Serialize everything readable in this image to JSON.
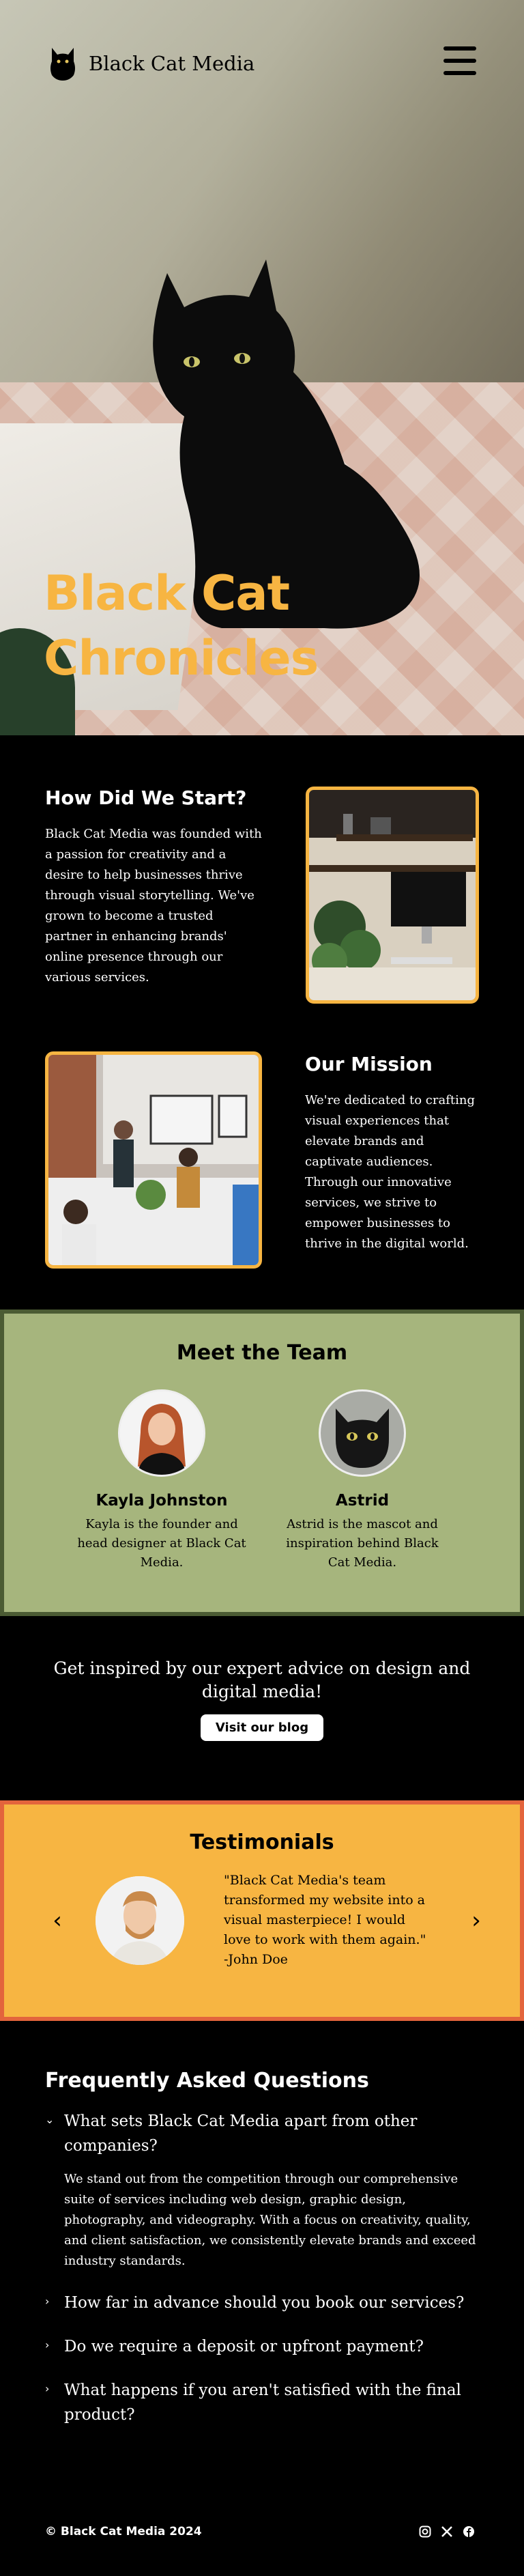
{
  "nav": {
    "brand_name": "Black Cat Media",
    "logo_icon": "cat-icon",
    "menu_icon": "hamburger-menu-icon"
  },
  "hero": {
    "title_line1": "Black Cat",
    "title_line2": "Chronicles"
  },
  "about": {
    "start_heading": "How Did We Start?",
    "start_text": "Black Cat Media was founded with a passion for creativity and a desire to help businesses thrive through visual storytelling. We've grown to become a trusted partner in enhancing brands' online presence through our various services.",
    "mission_heading": "Our Mission",
    "mission_text": "We're dedicated to crafting visual experiences that elevate brands and captivate audiences. Through our innovative services, we strive to empower businesses to thrive in the digital world."
  },
  "team": {
    "heading": "Meet the Team",
    "members": [
      {
        "name": "Kayla Johnston",
        "desc": "Kayla is the founder and head designer at Black Cat Media."
      },
      {
        "name": "Astrid",
        "desc": "Astrid is the mascot and inspiration behind Black Cat Media."
      }
    ]
  },
  "blog": {
    "text": "Get inspired by our expert advice on design and digital media!",
    "button": "Visit our blog"
  },
  "testimonials": {
    "heading": "Testimonials",
    "quote": "\"Black Cat Media's team transformed my website into a visual masterpiece! I would love to work with them again.\" -John Doe",
    "prev_icon": "chevron-left-icon",
    "next_icon": "chevron-right-icon"
  },
  "faq": {
    "heading": "Frequently Asked Questions",
    "items": [
      {
        "q": "What sets Black Cat Media apart from other companies?",
        "a": "We stand out from the competition through our comprehensive suite of services including web design, graphic design, photography, and videography. With a focus on creativity, quality, and client satisfaction, we consistently elevate brands and exceed industry standards.",
        "open": true
      },
      {
        "q": "How far in advance should you book our services?",
        "open": false
      },
      {
        "q": "Do we require a deposit or upfront payment?",
        "open": false
      },
      {
        "q": "What happens if you aren't satisfied with the final product?",
        "open": false
      }
    ]
  },
  "footer": {
    "copyright": "© Black Cat Media 2024",
    "socials": [
      "instagram-icon",
      "x-icon",
      "facebook-icon"
    ]
  },
  "colors": {
    "accent_yellow": "#f7b542",
    "team_green": "#a6b57d",
    "team_border": "#4b5b33",
    "testimonial_border": "#e3643c"
  }
}
